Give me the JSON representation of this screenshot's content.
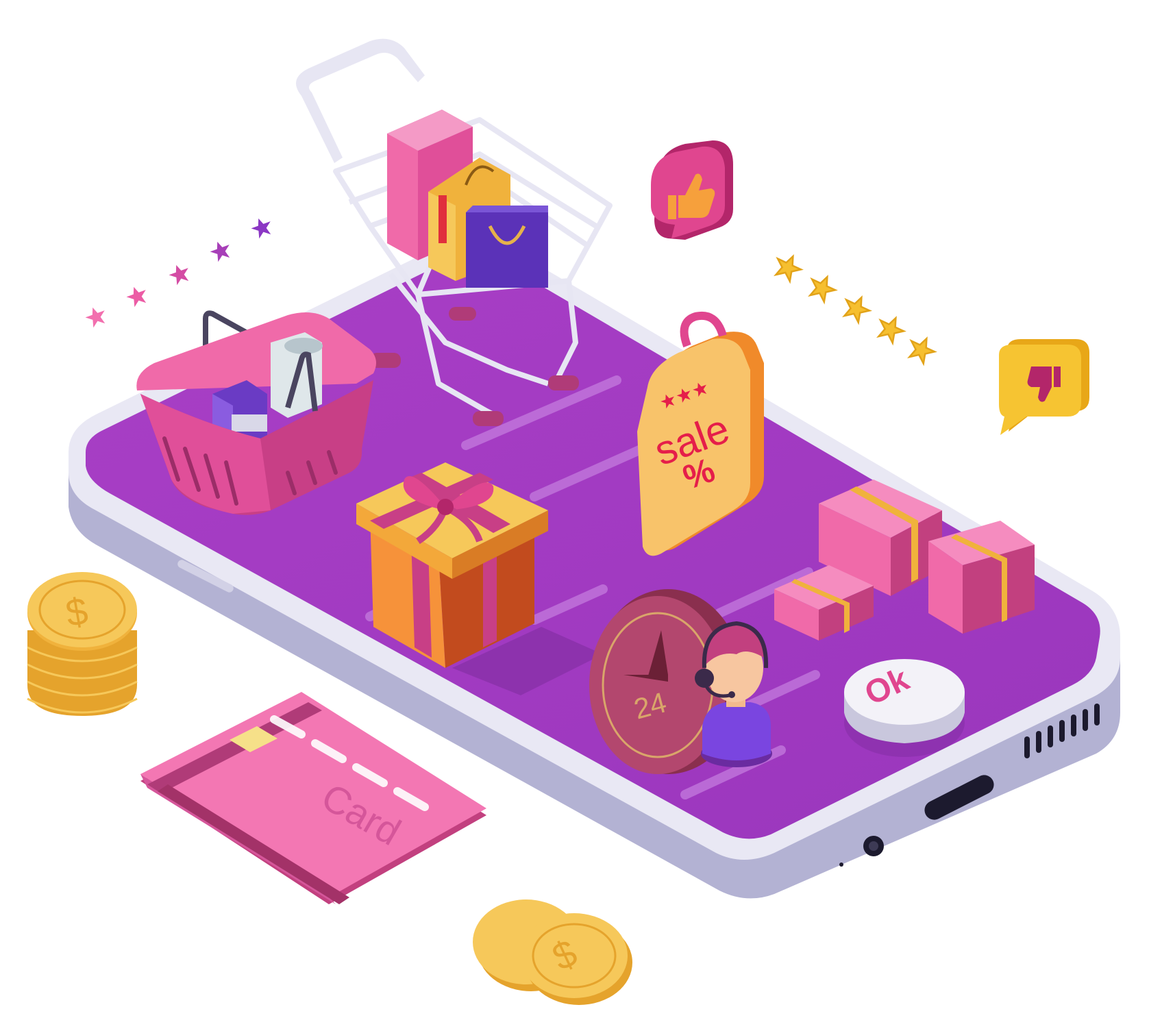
{
  "illustration": {
    "sale_tag": {
      "line1": "sale",
      "line2": "%"
    },
    "support_clock": {
      "label": "24"
    },
    "ok_button": {
      "label": "Ok"
    },
    "credit_card": {
      "label": "Card"
    },
    "coin_symbol": "$"
  },
  "colors": {
    "phone_screen": "#a43fc4",
    "phone_body": "#b9b8d6",
    "pink": "#f06aa9",
    "magenta": "#b03b78",
    "gold": "#f6bf45",
    "orange": "#f39a3f",
    "purple_bag": "#5b32b8",
    "card_pink": "#f377b3"
  },
  "icons": [
    "shopping-cart-icon",
    "shopping-basket-icon",
    "gift-box-icon",
    "sale-tag-icon",
    "thumbs-up-icon",
    "thumbs-down-icon",
    "star-icon",
    "coin-icon",
    "credit-card-icon",
    "support-agent-icon",
    "clock-icon",
    "parcel-icon"
  ]
}
